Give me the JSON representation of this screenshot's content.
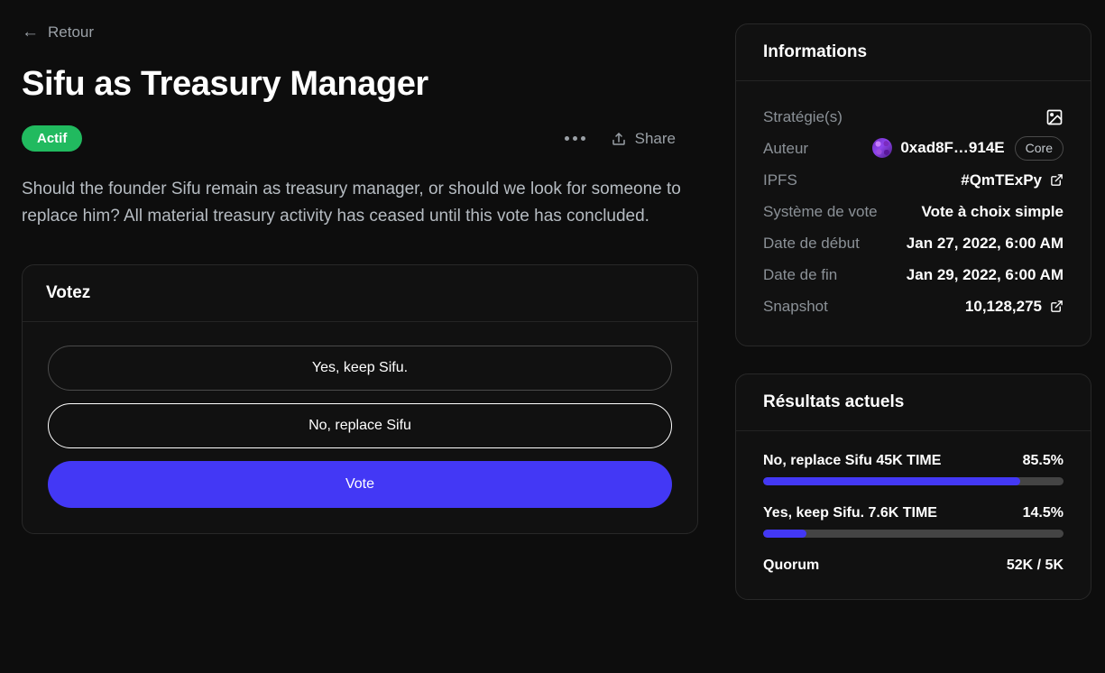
{
  "nav": {
    "back_label": "Retour",
    "back_icon": "arrow-left-icon"
  },
  "header": {
    "title": "Sifu as Treasury Manager",
    "status_badge": "Actif",
    "status_color": "#21ba5f",
    "more_icon": "ellipsis-icon",
    "share_label": "Share",
    "share_icon": "share-upload-icon"
  },
  "description": "Should the founder Sifu remain as treasury manager, or should we look for someone to replace him? All material treasury activity has ceased until this vote has concluded.",
  "vote_card": {
    "title": "Votez",
    "choices": [
      {
        "label": "Yes, keep Sifu.",
        "selected": false
      },
      {
        "label": "No, replace Sifu",
        "selected": true
      }
    ],
    "submit_label": "Vote",
    "submit_color": "#4338f5"
  },
  "information": {
    "title": "Informations",
    "rows": [
      {
        "label": "Stratégie(s)",
        "value": "",
        "icon": "image-strategy-icon"
      },
      {
        "label": "Auteur",
        "value": "0xad8F…914E",
        "badge": "Core",
        "avatar": "author-avatar"
      },
      {
        "label": "IPFS",
        "value": "#QmTExPy",
        "icon": "external-link-icon"
      },
      {
        "label": "Système de vote",
        "value": "Vote à choix simple"
      },
      {
        "label": "Date de début",
        "value": "Jan 27, 2022, 6:00 AM"
      },
      {
        "label": "Date de fin",
        "value": "Jan 29, 2022, 6:00 AM"
      },
      {
        "label": "Snapshot",
        "value": "10,128,275",
        "icon": "external-link-icon"
      }
    ]
  },
  "results": {
    "title": "Résultats actuels",
    "items": [
      {
        "name": "No, replace Sifu 45K TIME",
        "percent": "85.5%",
        "fill": 85.5
      },
      {
        "name": "Yes, keep Sifu. 7.6K TIME",
        "percent": "14.5%",
        "fill": 14.5
      }
    ],
    "quorum_label": "Quorum",
    "quorum_value": "52K / 5K"
  }
}
